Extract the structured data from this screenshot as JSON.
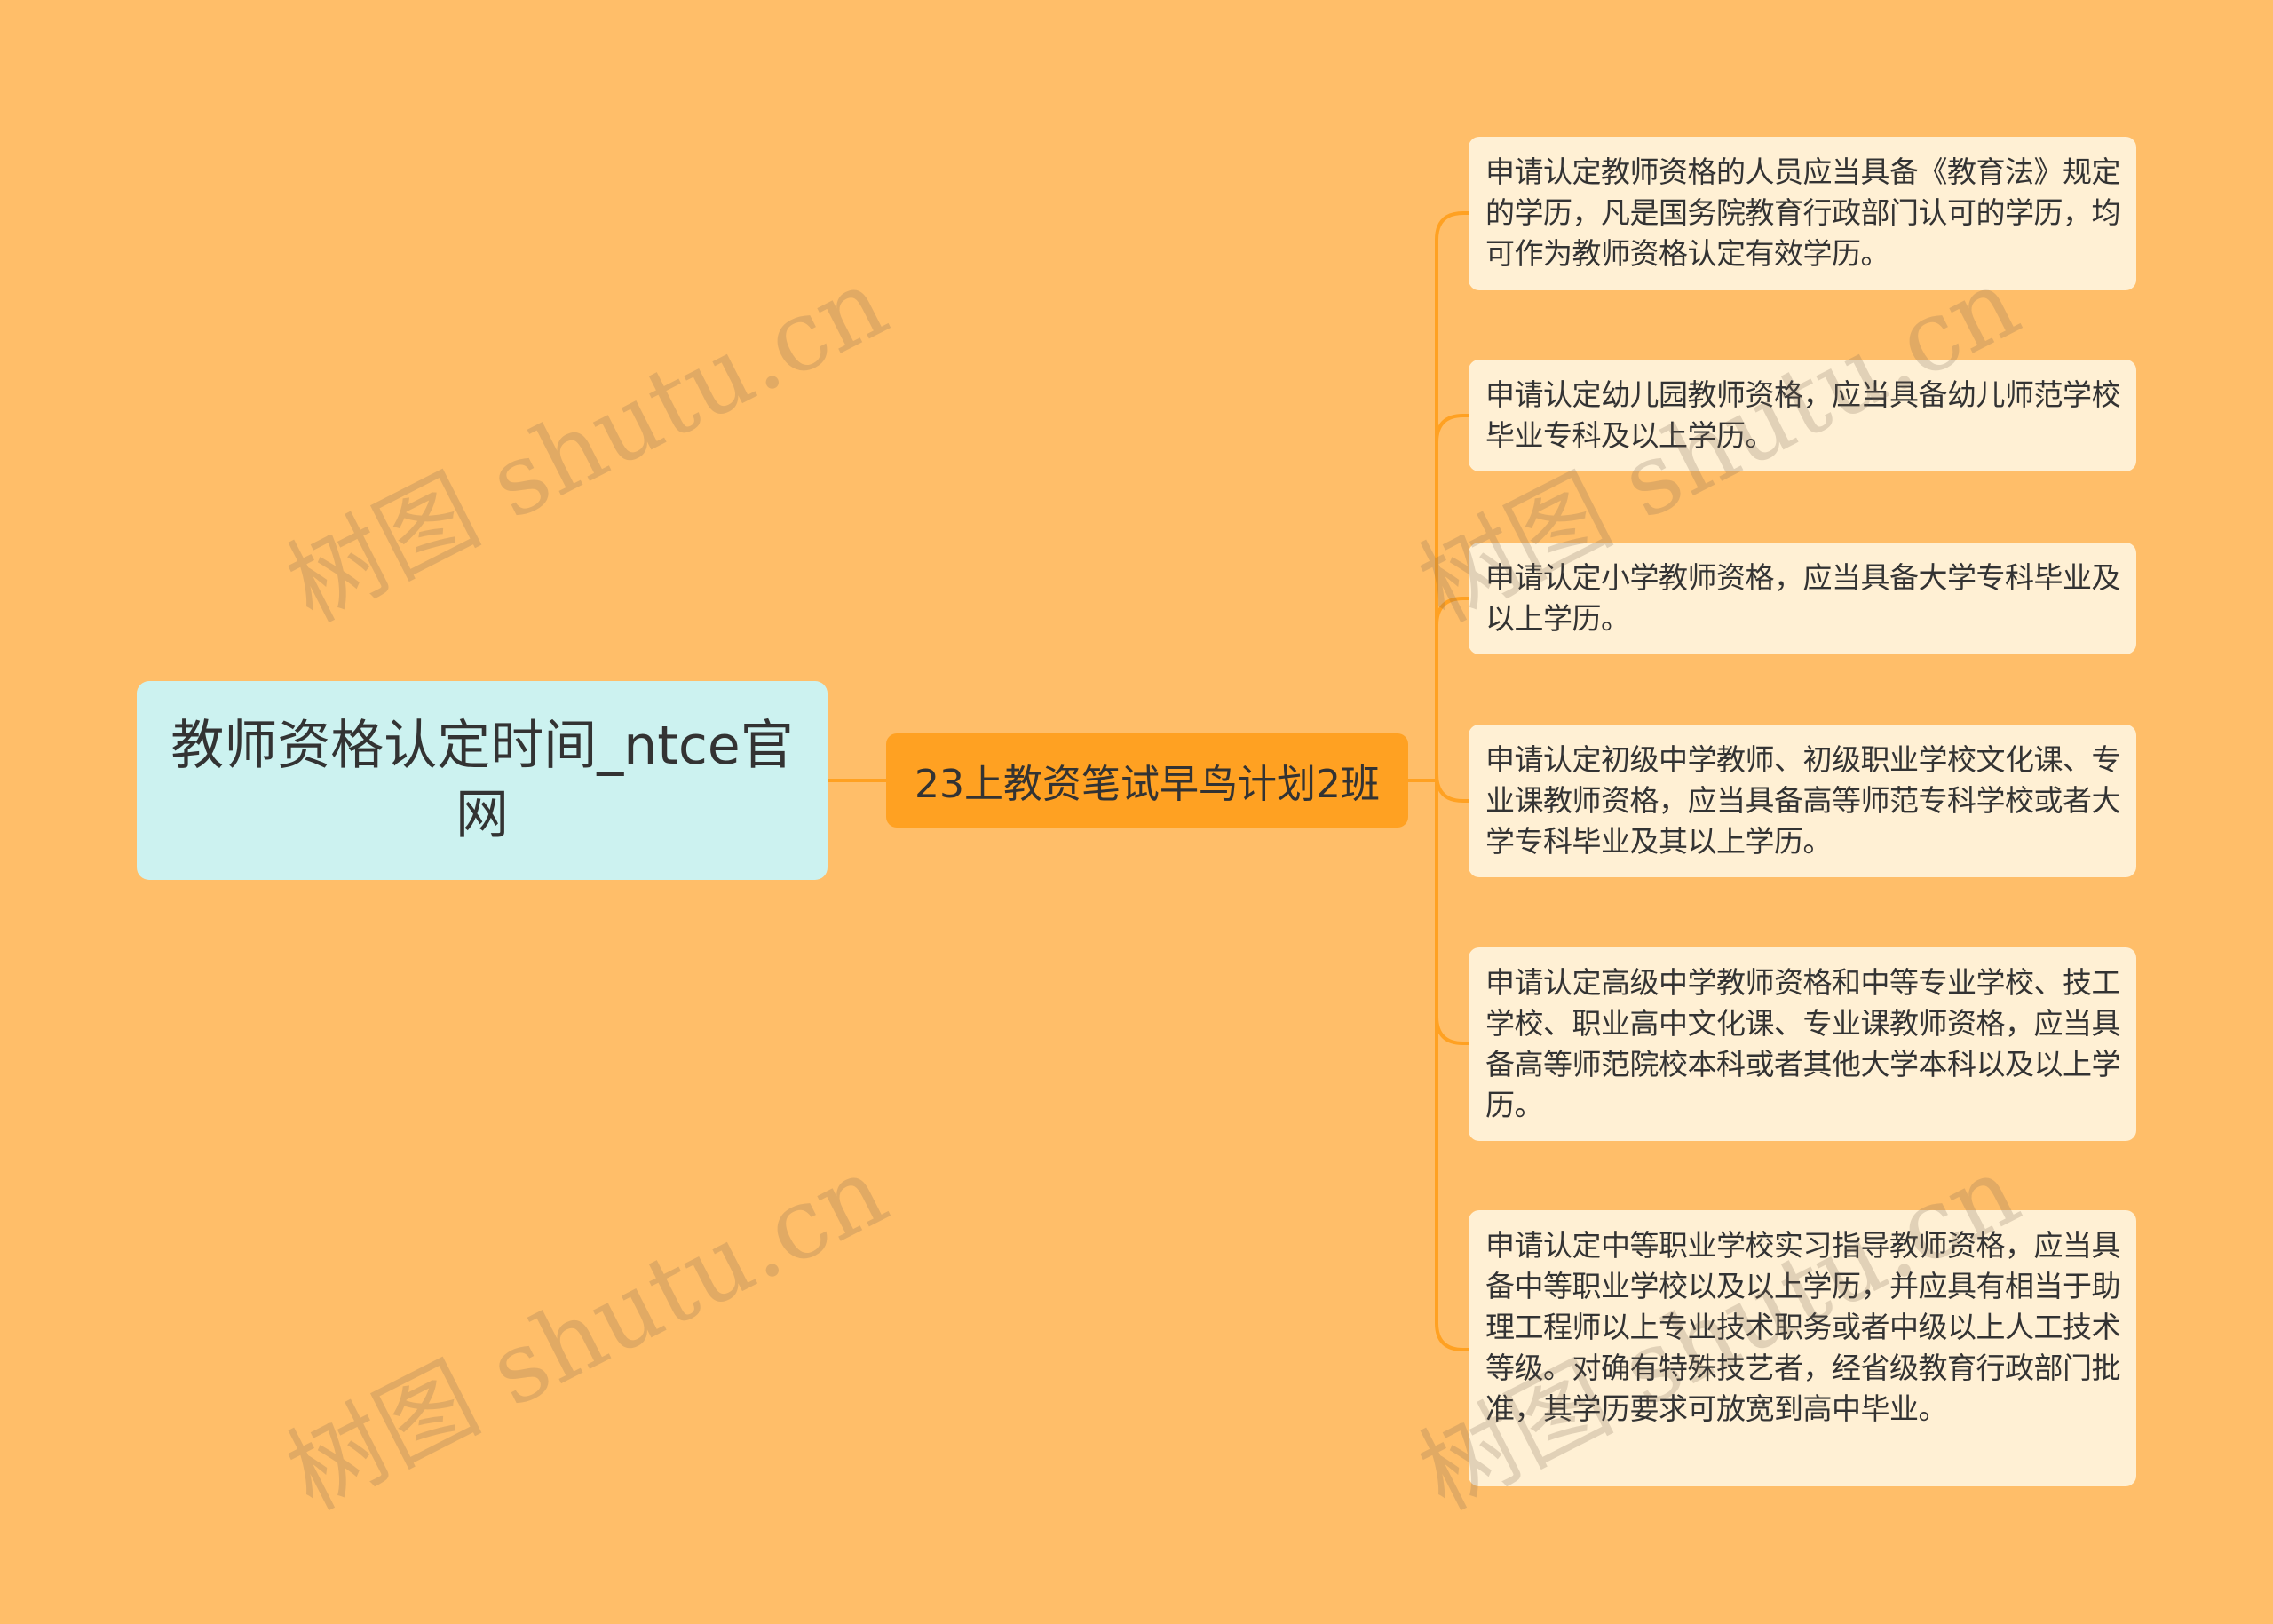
{
  "root": {
    "label": "教师资格认定时间_ntce官网"
  },
  "branch": {
    "label": "23上教资笔试早鸟计划2班"
  },
  "leaves": [
    "申请认定教师资格的人员应当具备《教育法》规定的学历，凡是国务院教育行政部门认可的学历，均可作为教师资格认定有效学历。",
    "申请认定幼儿园教师资格，应当具备幼儿师范学校毕业专科及以上学历。",
    "申请认定小学教师资格，应当具备大学专科毕业及以上学历。",
    "申请认定初级中学教师、初级职业学校文化课、专业课教师资格，应当具备高等师范专科学校或者大学专科毕业及其以上学历。",
    "申请认定高级中学教师资格和中等专业学校、技工学校、职业高中文化课、专业课教师资格，应当具备高等师范院校本科或者其他大学本科以及以上学历。",
    "申请认定中等职业学校实习指导教师资格，应当具备中等职业学校以及以上学历，并应具有相当于助理工程师以上专业技术职务或者中级以上人工技术等级。对确有特殊技艺者，经省级教育行政部门批准，其学历要求可放宽到高中毕业。"
  ],
  "watermark": {
    "text": "树图 shutu.cn"
  },
  "colors": {
    "background": "#FFBE69",
    "root_fill": "#CCF2F0",
    "branch_fill": "#FFA122",
    "leaf_fill": "#FFF0D4",
    "connector": "#FFA122",
    "text": "#333333"
  }
}
